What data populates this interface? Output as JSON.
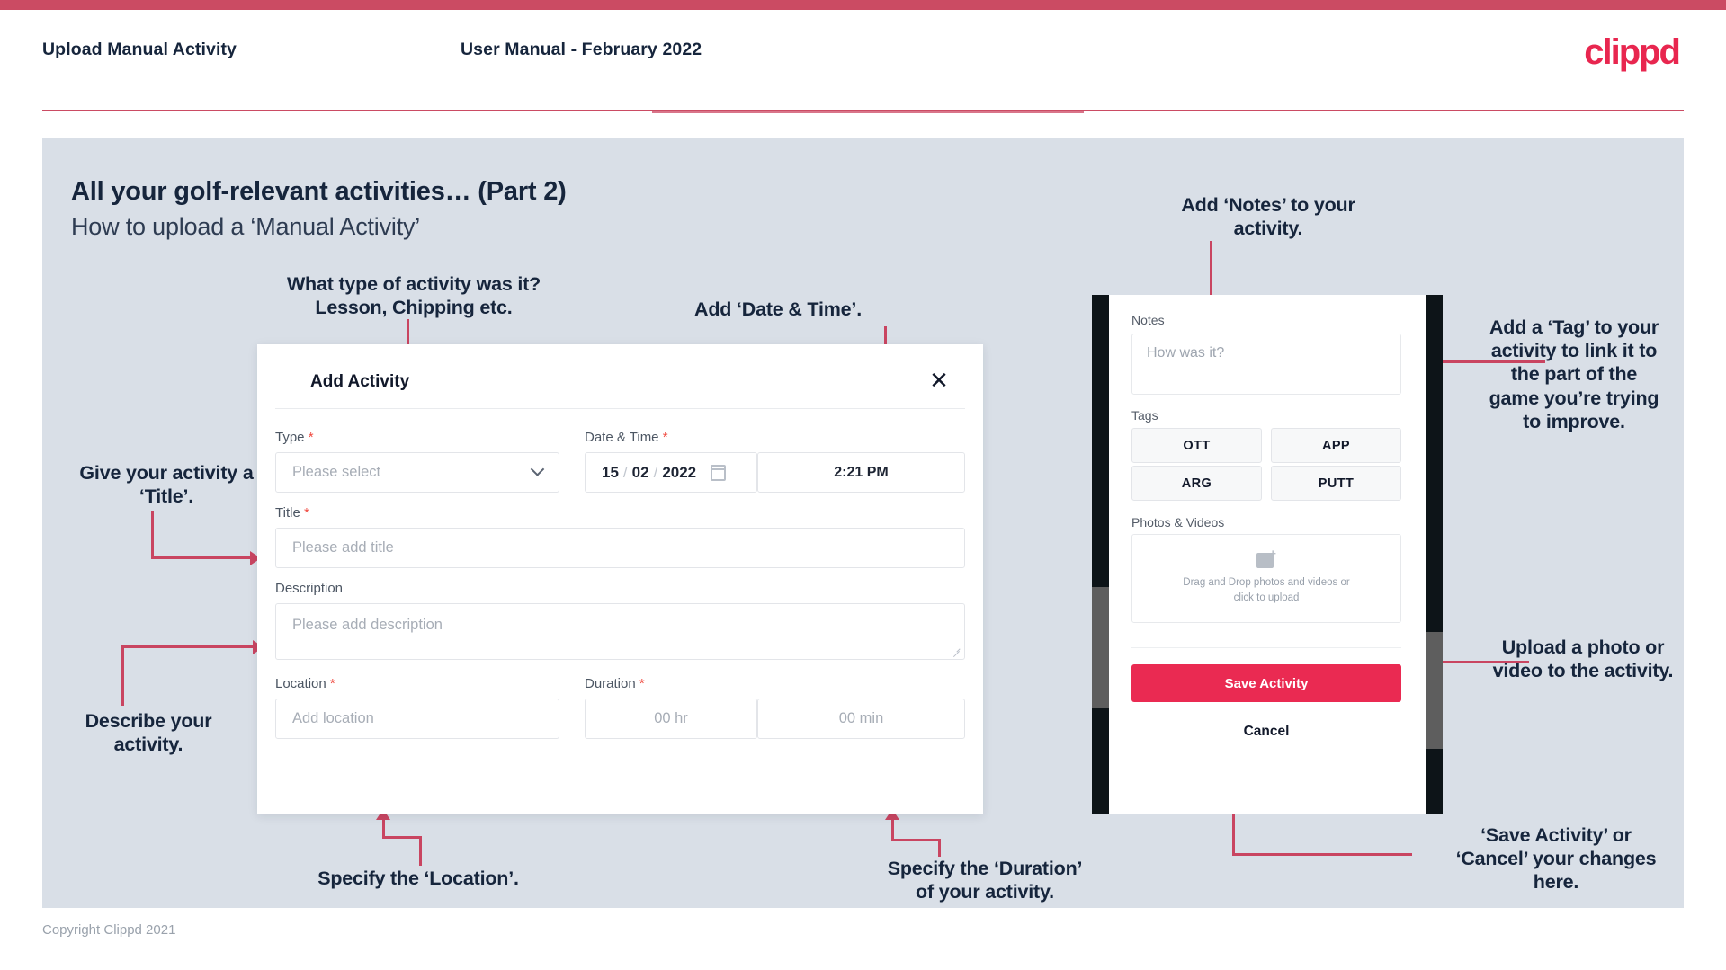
{
  "brand": {
    "logo_text": "clippd",
    "accent": "#e8264f",
    "bar_color": "#cb4b63"
  },
  "header": {
    "title": "Upload Manual Activity",
    "subtitle": "User Manual - February 2022"
  },
  "slide": {
    "heading": "All your golf-relevant activities… (Part 2)",
    "subheading": "How to upload a ‘Manual Activity’"
  },
  "footer": {
    "copyright": "Copyright Clippd 2021"
  },
  "dialog": {
    "title": "Add Activity",
    "close_icon": "close-icon",
    "fields": {
      "type": {
        "label": "Type",
        "required": "*",
        "placeholder": "Please select"
      },
      "datetime": {
        "label": "Date & Time",
        "required": "*",
        "day": "15",
        "month": "02",
        "year": "2022",
        "sep": "/",
        "time": "2:21 PM",
        "calendar_icon": "calendar-icon"
      },
      "title": {
        "label": "Title",
        "required": "*",
        "placeholder": "Please add title"
      },
      "description": {
        "label": "Description",
        "placeholder": "Please add description"
      },
      "location": {
        "label": "Location",
        "required": "*",
        "placeholder": "Add location"
      },
      "duration": {
        "label": "Duration",
        "required": "*",
        "hours": "00 hr",
        "minutes": "00 min"
      }
    }
  },
  "phone": {
    "notes": {
      "label": "Notes",
      "placeholder": "How was it?"
    },
    "tags": {
      "label": "Tags",
      "items": [
        "OTT",
        "APP",
        "ARG",
        "PUTT"
      ]
    },
    "photos": {
      "label": "Photos & Videos",
      "dropzone_line1": "Drag and Drop photos and videos or",
      "dropzone_line2": "click to upload",
      "icon": "image-add-icon"
    },
    "save_label": "Save Activity",
    "cancel_label": "Cancel",
    "save_color": "#ea2a52"
  },
  "annotations": {
    "type": "What type of activity was it?\nLesson, Chipping etc.",
    "datetime": "Add ‘Date & Time’.",
    "title": "Give your activity a\n‘Title’.",
    "description": "Describe your\nactivity.",
    "location": "Specify the ‘Location’.",
    "duration": "Specify the ‘Duration’\nof your activity.",
    "notes": "Add ‘Notes’ to your\nactivity.",
    "tags": "Add a ‘Tag’ to your\nactivity to link it to\nthe part of the\ngame you’re trying\nto improve.",
    "photos": "Upload a photo or\nvideo to the activity.",
    "save": "‘Save Activity’ or\n‘Cancel’ your changes\nhere."
  }
}
